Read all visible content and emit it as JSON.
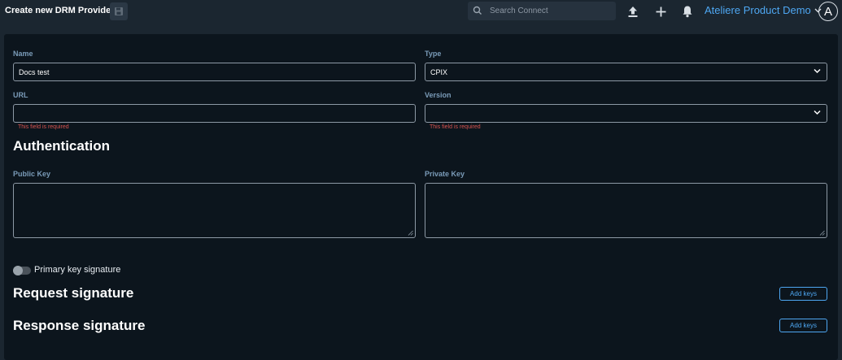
{
  "header": {
    "title": "Create new DRM Provider",
    "search_placeholder": "Search Connect",
    "org_name": "Ateliere Product Demo",
    "avatar_initial": "A"
  },
  "form": {
    "name": {
      "label": "Name",
      "value": "Docs test"
    },
    "type": {
      "label": "Type",
      "value": "CPIX"
    },
    "url": {
      "label": "URL",
      "value": "",
      "error": "This field is required"
    },
    "version": {
      "label": "Version",
      "value": "",
      "error": "This field is required"
    }
  },
  "authentication": {
    "heading": "Authentication",
    "public_key_label": "Public Key",
    "private_key_label": "Private Key"
  },
  "primary_key_signature": {
    "label": "Primary key signature",
    "enabled": false
  },
  "request_signature": {
    "heading": "Request signature",
    "button_label": "Add keys"
  },
  "response_signature": {
    "heading": "Response signature",
    "button_label": "Add keys"
  },
  "colors": {
    "accent": "#4ea7f2",
    "error": "#d9534f",
    "panel_bg": "#0c151d",
    "topbar_bg": "#1b2630"
  },
  "icons": [
    "save-icon",
    "search-icon",
    "upload-icon",
    "plus-icon",
    "bell-icon",
    "chevron-down-icon",
    "avatar"
  ]
}
